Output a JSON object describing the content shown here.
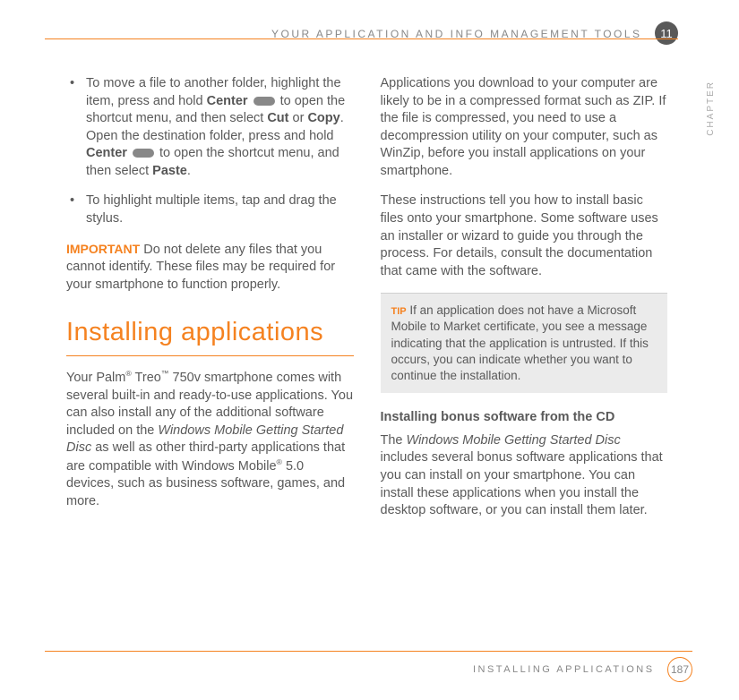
{
  "header": {
    "title": "YOUR APPLICATION AND INFO MANAGEMENT TOOLS",
    "chapter_num": "11"
  },
  "side_label": "CHAPTER",
  "col1": {
    "bullet1_a": "To move a file to another folder, highlight the item, press and hold ",
    "bullet1_center": "Center",
    "bullet1_b": " to open the shortcut menu, and then select ",
    "bullet1_cut": "Cut",
    "bullet1_or": " or ",
    "bullet1_copy": "Copy",
    "bullet1_c": ". Open the destination folder, press and hold ",
    "bullet1_center2": "Center",
    "bullet1_d": " to open the shortcut menu, and then select ",
    "bullet1_paste": "Paste",
    "bullet1_e": ".",
    "bullet2": "To highlight multiple items, tap and drag the stylus.",
    "important_label": "IMPORTANT",
    "important_text": "  Do not delete any files that you cannot identify. These files may be required for your smartphone to function properly.",
    "heading": "Installing applications",
    "para_a": "Your Palm",
    "reg": "®",
    "para_b": " Treo",
    "tm": "™",
    "para_c": " 750v smartphone comes with several built-in and ready-to-use applications. You can also install any of the additional software included on the ",
    "disc": "Windows Mobile Getting Started Disc",
    "para_d": " as well as other third-party applications that are compatible with Windows Mobile",
    "reg2": "®",
    "para_e": " 5.0 devices, such as business software, games, and more."
  },
  "col2": {
    "p1": "Applications you download to your computer are likely to be in a compressed format such as ZIP. If the file is compressed, you need to use a decompression utility on your computer, such as WinZip, before you install applications on your smartphone.",
    "p2": "These instructions tell you how to install basic files onto your smartphone. Some software uses an installer or wizard to guide you through the process. For details, consult the documentation that came with the software.",
    "tip_label": "TIP",
    "tip_text": " If an application does not have a Microsoft Mobile to Market certificate, you see a message indicating that the application is untrusted. If this occurs, you can indicate whether you want to continue the installation.",
    "subhead": "Installing bonus software from the CD",
    "p3_a": "The ",
    "p3_disc": "Windows Mobile Getting Started Disc",
    "p3_b": " includes several bonus software applications that you can install on your smartphone. You can install these applications when you install the desktop software, or you can install them later."
  },
  "footer": {
    "title": "INSTALLING APPLICATIONS",
    "page": "187"
  }
}
